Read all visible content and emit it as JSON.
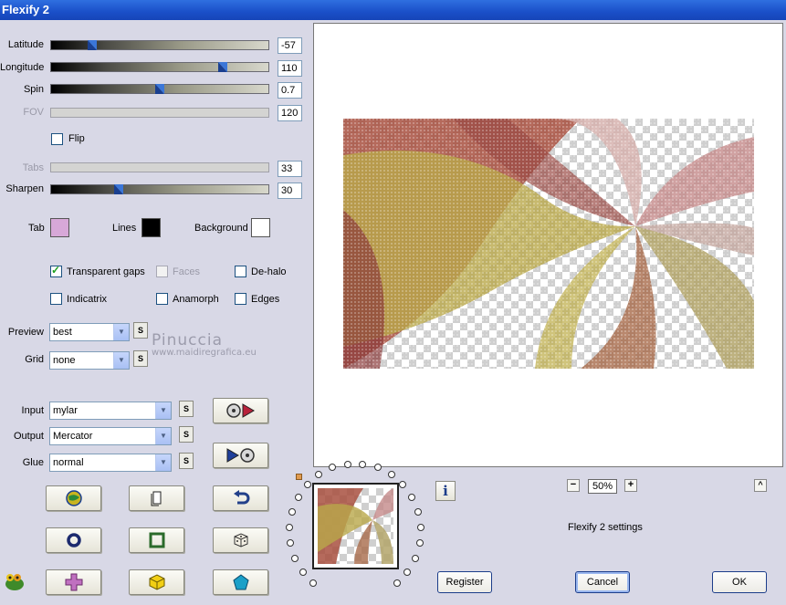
{
  "window": {
    "title": "Flexify 2"
  },
  "sliders": [
    {
      "key": "latitude",
      "label": "Latitude",
      "value": "-57",
      "position": 0.19,
      "enabled": true
    },
    {
      "key": "longitude",
      "label": "Longitude",
      "value": "110",
      "position": 0.79,
      "enabled": true
    },
    {
      "key": "spin",
      "label": "Spin",
      "value": "0.7",
      "position": 0.5,
      "enabled": true
    },
    {
      "key": "fov",
      "label": "FOV",
      "value": "120",
      "position": null,
      "enabled": false
    },
    {
      "key": "tabs",
      "label": "Tabs",
      "value": "33",
      "position": null,
      "enabled": false
    },
    {
      "key": "sharpen",
      "label": "Sharpen",
      "value": "30",
      "position": 0.31,
      "enabled": true
    }
  ],
  "flip": {
    "label": "Flip",
    "checked": false
  },
  "colors": {
    "tab": {
      "label": "Tab",
      "color": "#d7a8d8"
    },
    "lines": {
      "label": "Lines",
      "color": "#000000"
    },
    "background": {
      "label": "Background",
      "color": "#ffffff"
    }
  },
  "options": {
    "transparent_gaps": {
      "label": "Transparent gaps",
      "checked": true
    },
    "faces": {
      "label": "Faces",
      "checked": false,
      "enabled": false
    },
    "de_halo": {
      "label": "De-halo",
      "checked": false
    },
    "indicatrix": {
      "label": "Indicatrix",
      "checked": false
    },
    "anamorph": {
      "label": "Anamorph",
      "checked": false
    },
    "edges": {
      "label": "Edges",
      "checked": false
    }
  },
  "selects": {
    "preview": {
      "label": "Preview",
      "value": "best"
    },
    "grid": {
      "label": "Grid",
      "value": "none"
    },
    "input": {
      "label": "Input",
      "value": "mylar"
    },
    "output": {
      "label": "Output",
      "value": "Mercator"
    },
    "glue": {
      "label": "Glue",
      "value": "normal"
    }
  },
  "s_button_label": "S",
  "watermark": {
    "line1": "Pinuccia",
    "line2": "www.maidiregrafica.eu"
  },
  "zoom": {
    "value": "50%",
    "minus": "−",
    "plus": "+"
  },
  "settings_text": "Flexify 2 settings",
  "buttons": {
    "register": "Register",
    "cancel": "Cancel",
    "ok": "OK"
  },
  "accent_colors": {
    "title_bar": "#1a4fc8",
    "panel": "#d8d8e6"
  }
}
